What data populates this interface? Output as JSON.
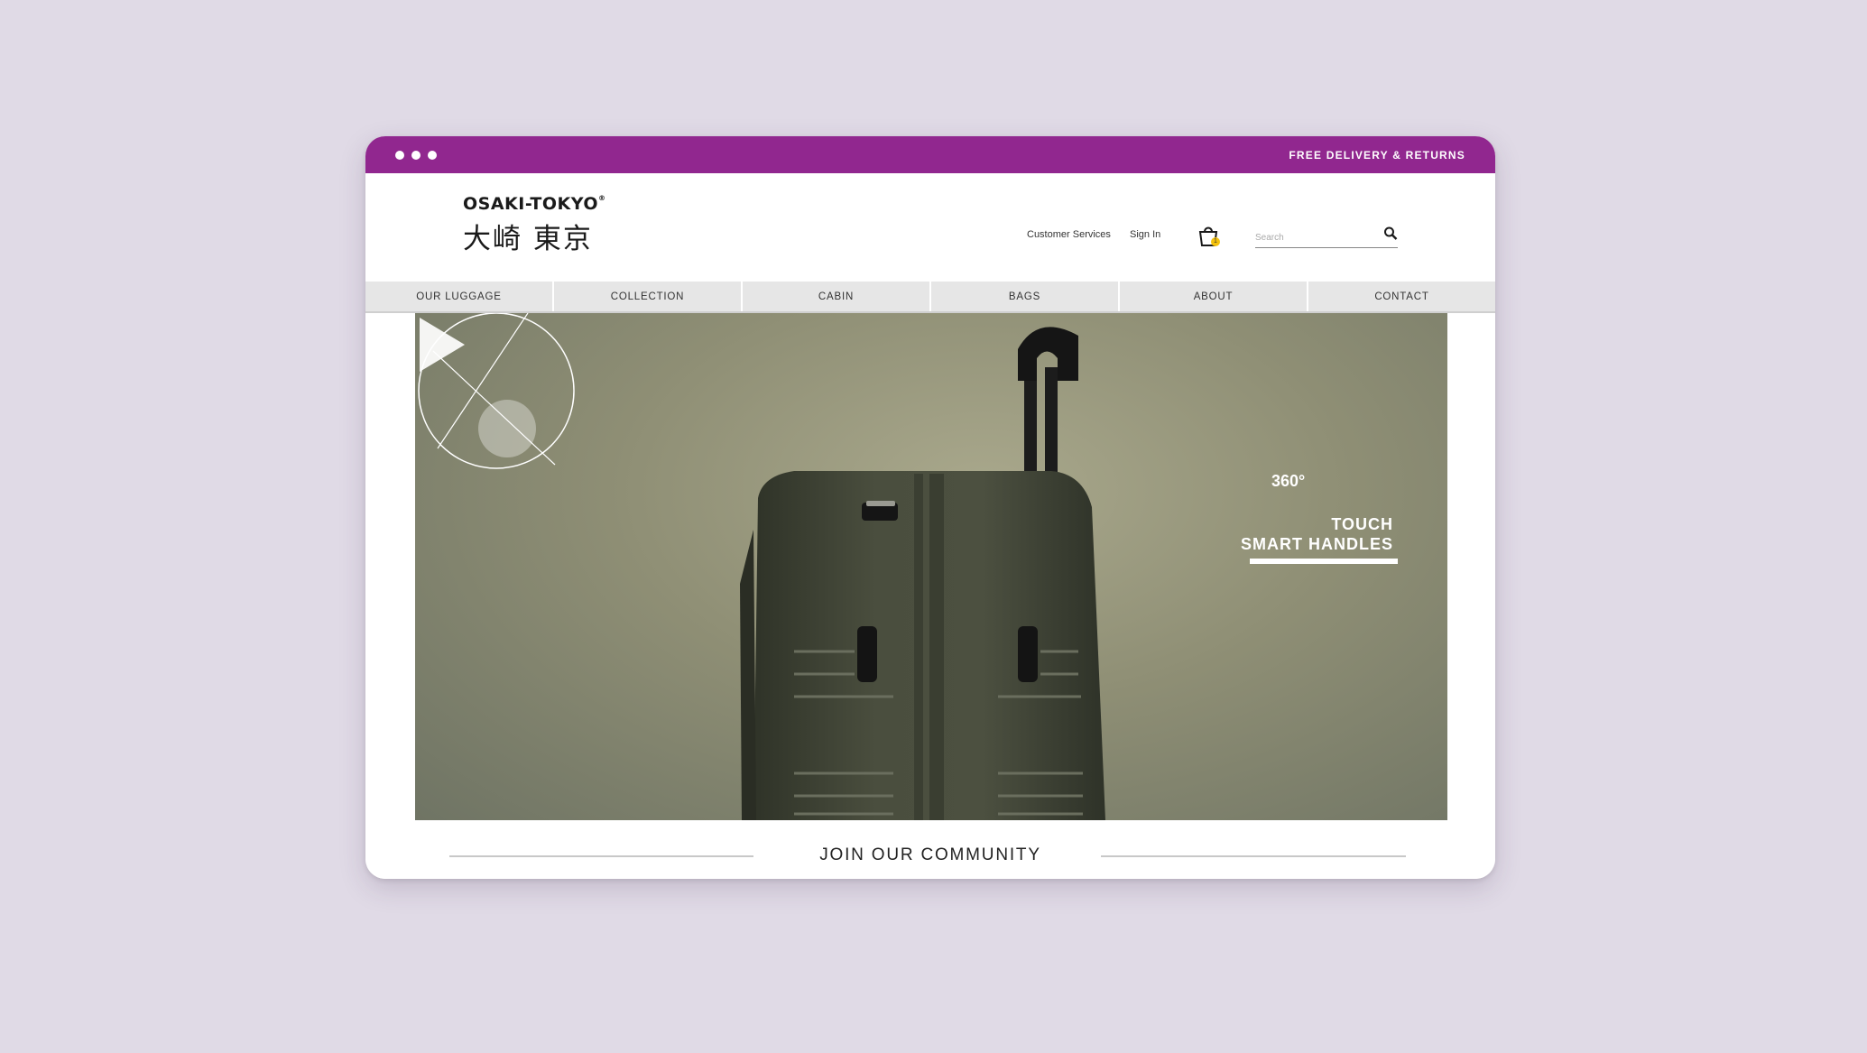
{
  "topbar": {
    "promo": "FREE DELIVERY & RETURNS",
    "color": "#91278f"
  },
  "logo": {
    "name": "OSAKI-TOKYO",
    "mark": "®",
    "jp": "大崎 東京"
  },
  "header": {
    "customer_services": "Customer Services",
    "sign_in": "Sign In",
    "cart_count": "1",
    "search_placeholder": "Search"
  },
  "nav": {
    "items": [
      {
        "label": "OUR LUGGAGE"
      },
      {
        "label": "COLLECTION"
      },
      {
        "label": "CABIN"
      },
      {
        "label": "BAGS"
      },
      {
        "label": "ABOUT"
      },
      {
        "label": "CONTACT"
      }
    ]
  },
  "hero": {
    "degree_label": "360°",
    "touch_line1": "TOUCH",
    "touch_line2": "SMART HANDLES"
  },
  "community": {
    "title": "JOIN OUR COMMUNITY"
  }
}
